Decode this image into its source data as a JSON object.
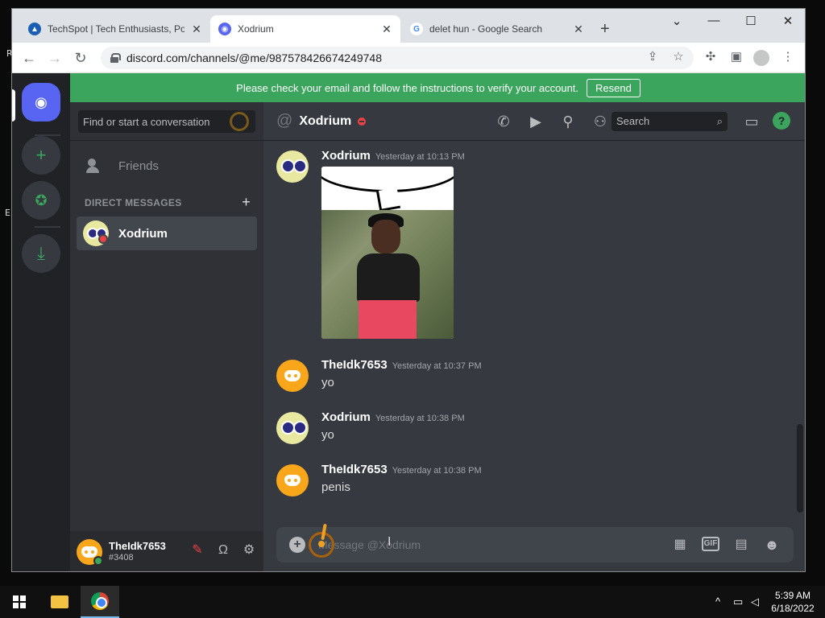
{
  "desktop": {
    "fragment_top": "R",
    "fragment_mid": "E"
  },
  "browser": {
    "tabs": [
      {
        "title": "TechSpot | Tech Enthusiasts, Pow",
        "icon": "techspot-icon"
      },
      {
        "title": "Xodrium",
        "icon": "discord-icon"
      },
      {
        "title": "delet hun - Google Search",
        "icon": "google-icon"
      }
    ],
    "url": "discord.com/channels/@me/987578426674249748"
  },
  "discord": {
    "banner": {
      "text": "Please check your email and follow the instructions to verify your account.",
      "resend_label": "Resend"
    },
    "dm": {
      "search_placeholder": "Find or start a conversation",
      "friends_label": "Friends",
      "header": "DIRECT MESSAGES",
      "items": [
        {
          "name": "Xodrium",
          "status": "dnd"
        }
      ]
    },
    "user": {
      "name": "TheIdk7653",
      "tag": "#3408",
      "status": "online"
    },
    "chat": {
      "title": "Xodrium",
      "search_placeholder": "Search",
      "composer_placeholder": "Message @Xodrium",
      "messages": [
        {
          "author": "Xodrium",
          "time": "Yesterday at 10:13 PM",
          "text": "",
          "attachment": "image"
        },
        {
          "author": "TheIdk7653",
          "time": "Yesterday at 10:37 PM",
          "text": "yo"
        },
        {
          "author": "Xodrium",
          "time": "Yesterday at 10:38 PM",
          "text": "yo"
        },
        {
          "author": "TheIdk7653",
          "time": "Yesterday at 10:38 PM",
          "text": "penis"
        }
      ]
    },
    "colors": {
      "blurple": "#5865f2",
      "green": "#3ba55d",
      "red": "#ed4245",
      "bg": "#36393f"
    }
  },
  "taskbar": {
    "time": "5:39 AM",
    "date": "6/18/2022"
  }
}
